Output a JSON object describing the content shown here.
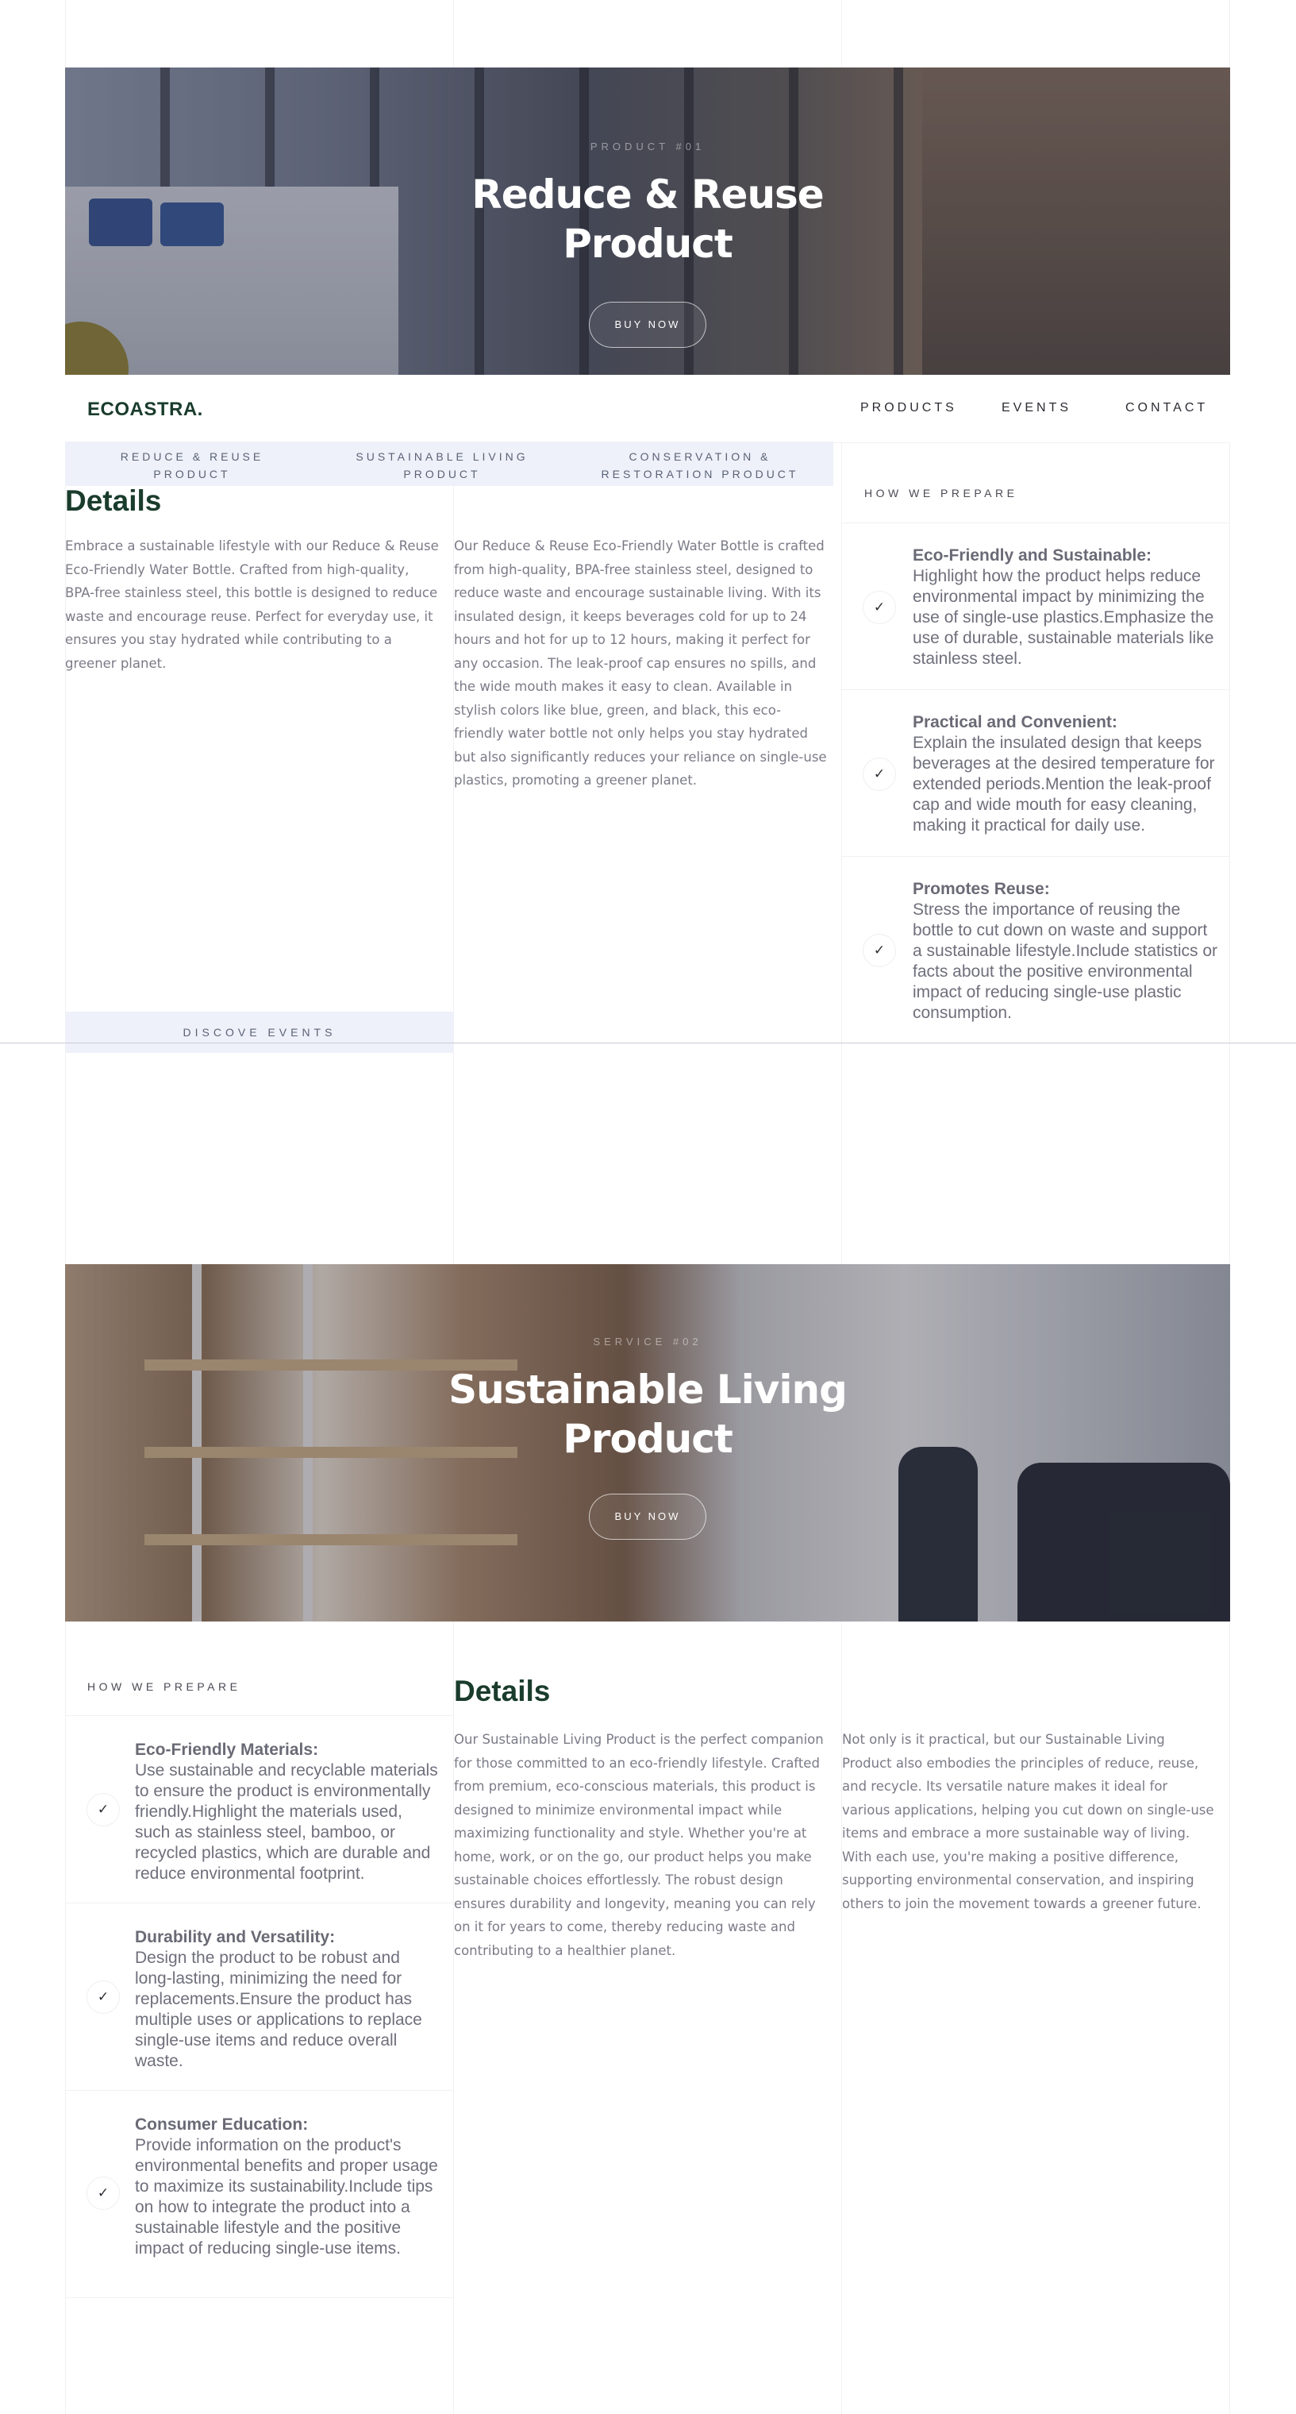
{
  "brand": "ECOASTRA.",
  "nav": {
    "products": "PRODUCTS",
    "events": "EVENTS",
    "contact": "CONTACT"
  },
  "subnav": [
    "REDUCE & REUSE PRODUCT",
    "SUSTAINABLE LIVING PRODUCT",
    "CONSERVATION & RESTORATION PRODUCT"
  ],
  "discover_label": "DISCOVE EVENTS",
  "hero1": {
    "kicker": "PRODUCT #01",
    "title_line1": "Reduce & Reuse",
    "title_line2": "Product",
    "button": "BUY NOW"
  },
  "hero2": {
    "kicker": "SERVICE #02",
    "title_line1": "Sustainable Living",
    "title_line2": "Product",
    "button": "BUY NOW"
  },
  "section1": {
    "heading": "Details",
    "para_left": "Embrace a sustainable lifestyle with our Reduce & Reuse Eco-Friendly Water Bottle. Crafted from high-quality, BPA-free stainless steel, this bottle is designed to reduce waste and encourage reuse. Perfect for everyday use, it ensures you stay hydrated while contributing to a greener planet.",
    "para_right": "Our Reduce & Reuse Eco-Friendly Water Bottle is crafted from high-quality, BPA-free stainless steel, designed to reduce waste and encourage sustainable living. With its insulated design, it keeps beverages cold for up to 24 hours and hot for up to 12 hours, making it perfect for any occasion. The leak-proof cap ensures no spills, and the wide mouth makes it easy to clean. Available in stylish colors like blue, green, and black, this eco-friendly water bottle not only helps you stay hydrated but also significantly reduces your reliance on single-use plastics, promoting a greener planet.",
    "prepare_label": "HOW WE PREPARE",
    "prepare": [
      {
        "title": "Eco-Friendly and Sustainable:",
        "body": "Highlight how the product helps reduce environmental impact by minimizing the use of single-use plastics.Emphasize the use of durable, sustainable materials like stainless steel."
      },
      {
        "title": "Practical and Convenient:",
        "body": "Explain the insulated design that keeps beverages at the desired temperature for extended periods.Mention the leak-proof cap and wide mouth for easy cleaning, making it practical for daily use."
      },
      {
        "title": "Promotes Reuse:",
        "body": "Stress the importance of reusing the bottle to cut down on waste and support a sustainable lifestyle.Include statistics or facts about the positive environmental impact of reducing single-use plastic consumption."
      }
    ]
  },
  "section2": {
    "heading": "Details",
    "para_left": "Our Sustainable Living Product is the perfect companion for those committed to an eco-friendly lifestyle. Crafted from premium, eco-conscious materials, this product is designed to minimize environmental impact while maximizing functionality and style. Whether you're at home, work, or on the go, our product helps you make sustainable choices effortlessly. The robust design ensures durability and longevity, meaning you can rely on it for years to come, thereby reducing waste and contributing to a healthier planet.",
    "para_right": "Not only is it practical, but our Sustainable Living Product also embodies the principles of reduce, reuse, and recycle. Its versatile nature makes it ideal for various applications, helping you cut down on single-use items and embrace a more sustainable way of living. With each use, you're making a positive difference, supporting environmental conservation, and inspiring others to join the movement towards a greener future.",
    "prepare_label": "HOW WE PREPARE",
    "prepare": [
      {
        "title": "Eco-Friendly Materials:",
        "body": "Use sustainable and recyclable materials to ensure the product is environmentally friendly.Highlight the materials used, such as stainless steel, bamboo, or recycled plastics, which are durable and reduce environmental footprint."
      },
      {
        "title": "Durability and Versatility:",
        "body": "Design the product to be robust and long-lasting, minimizing the need for replacements.Ensure the product has multiple uses or applications to replace single-use items and reduce overall waste."
      },
      {
        "title": "Consumer Education:",
        "body": "Provide information on the product's environmental benefits and proper usage to maximize its sustainability.Include tips on how to integrate the product into a sustainable lifestyle and the positive impact of reducing single-use items."
      }
    ]
  },
  "icons": {
    "check": "check-icon"
  }
}
